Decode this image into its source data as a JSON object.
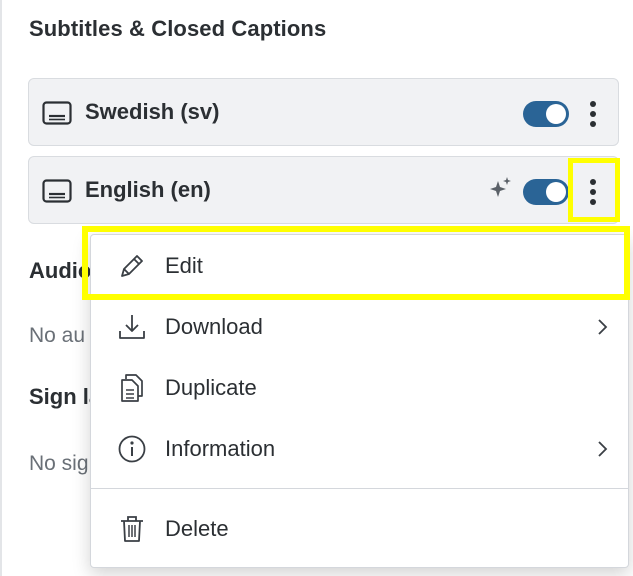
{
  "section": {
    "title": "Subtitles & Closed Captions"
  },
  "tracks": [
    {
      "label": "Swedish (sv)",
      "enabled": true,
      "ai_generated": false,
      "icon": "closed-caption-icon"
    },
    {
      "label": "English (en)",
      "enabled": true,
      "ai_generated": true,
      "icon": "closed-caption-icon"
    }
  ],
  "background": {
    "audio_heading": "Audio",
    "audio_empty": "No au",
    "sign_heading": "Sign la",
    "sign_empty": "No sig"
  },
  "menu": {
    "items": [
      {
        "label": "Edit",
        "icon": "pencil-icon",
        "has_submenu": false
      },
      {
        "label": "Download",
        "icon": "download-icon",
        "has_submenu": true
      },
      {
        "label": "Duplicate",
        "icon": "duplicate-icon",
        "has_submenu": false
      },
      {
        "label": "Information",
        "icon": "info-icon",
        "has_submenu": true
      },
      {
        "label": "Delete",
        "icon": "trash-icon",
        "has_submenu": false
      }
    ]
  },
  "colors": {
    "toggle_on": "#2a6496",
    "highlight": "#ffff00",
    "row_bg": "#f1f2f4"
  }
}
